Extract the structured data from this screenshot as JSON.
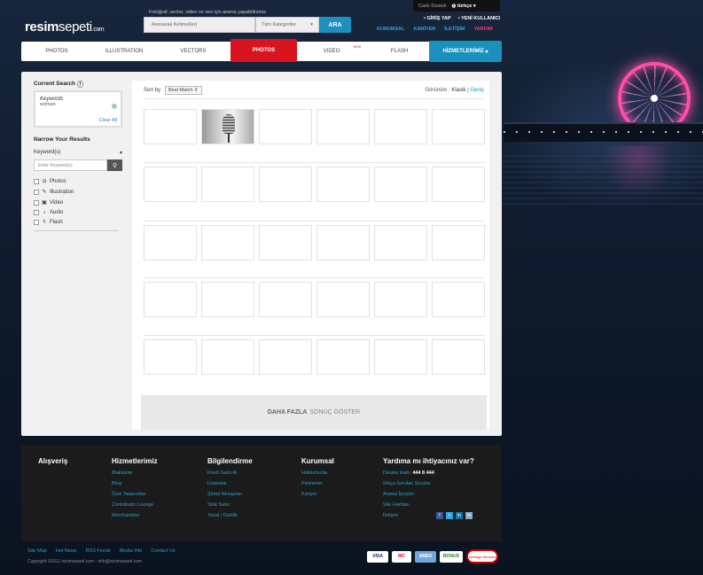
{
  "top": {
    "support": "Canlı Destek",
    "language": "türkçe"
  },
  "logo": {
    "bold": "resim",
    "rest": "sepeti",
    "suffix": ".com"
  },
  "tagline": "Fotoğraf, vector, video ve ses için arama yapabilirsiniz.",
  "search": {
    "placeholder": "Aranacak Kelime(ler)",
    "category": "Tüm Kategoriler",
    "button": "ARA"
  },
  "account": {
    "login": "GİRİŞ YAP",
    "new_user": "YENİ KULLANICI"
  },
  "toplinks": [
    "KURUMSAL",
    "KARİYER",
    "İLETİŞİM",
    "YARDIM"
  ],
  "nav": {
    "items": [
      "PHOTOS",
      "ILLUSTRATION",
      "VECTORS",
      "PHOTOS",
      "VIDEO",
      "FLASH"
    ],
    "new_badge": "NEW",
    "services": "HİZMETLERİMİZ"
  },
  "sidebar": {
    "current_search": "Current Search",
    "keywords_label": "Keywords",
    "keyword_value": "woman",
    "clear_all": "Clear All",
    "narrow": "Narrow Your Results",
    "keywords_section": "Keyword(s)",
    "enter_placeholder": "Enter Keyword(s)",
    "filters": [
      "Photos",
      "Illustration",
      "Video",
      "Audio",
      "Flash"
    ]
  },
  "results": {
    "sort_label": "Sort by",
    "sort_value": "Best Match",
    "view_label": "Görünüm :",
    "view_classic": "Klasik",
    "view_wide": "Geniş",
    "more_bold": "DAHA FAZLA",
    "more_rest": "SONUÇ GÖSTER"
  },
  "footer": {
    "cols": [
      {
        "title": "Alışveriş",
        "links": []
      },
      {
        "title": "Hizmetlerimiz",
        "links": [
          "Makaleler",
          "Blog",
          "Özel Tasarımlar",
          "Contributor Lounge",
          "Merchandise"
        ]
      },
      {
        "title": "Bilgilendirme",
        "links": [
          "Kredi Satın Al",
          "Lisanslar",
          "Şirket Hesapları",
          "Stok Satın",
          "Yasal / Gizlilik"
        ]
      },
      {
        "title": "Kurumsal",
        "links": [
          "Hakkımızda",
          "Partnerler",
          "Kariyer"
        ]
      },
      {
        "title": "Yardıma mı ihtiyacınız var?",
        "hotline_label": "Destek Hattı:",
        "hotline": "444 8 444",
        "links": [
          "Sıkça Sorulan Sorular",
          "Arama İpuçları",
          "Site Haritası",
          "İletişim"
        ]
      }
    ],
    "bottom_links": [
      "Site Map",
      "Hot News",
      "RSS Feeds",
      "Media Info",
      "Contact Us"
    ],
    "copyright": "Copyright ©2011 resimsepeti.com - info@resimsepeti.com",
    "payments": [
      "VISA",
      "MC",
      "AMEX",
      "BONUS",
      "Verisign Secured"
    ]
  }
}
